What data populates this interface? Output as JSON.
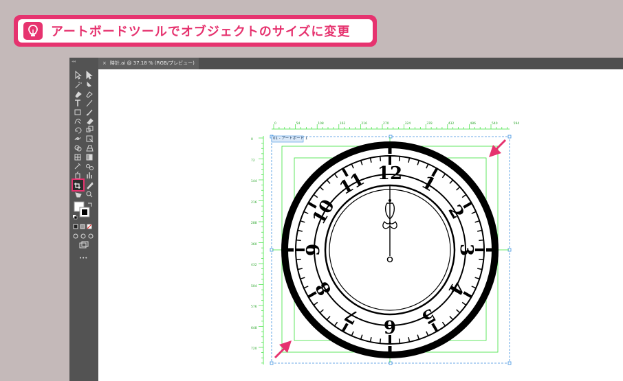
{
  "banner": {
    "text": "アートボードツールでオブジェクトのサイズに変更",
    "icon": "lightbulb-icon",
    "accent": "#e6336f"
  },
  "document": {
    "tab_title": "時計.ai @ 37.18 % (RGB/プレビュー)",
    "close_glyph": "×"
  },
  "artboard": {
    "label": "01 - アートボード 1"
  },
  "rulers": {
    "top": [
      "0",
      "54",
      "108",
      "162",
      "216",
      "270",
      "324",
      "378",
      "432",
      "486",
      "540",
      "594"
    ],
    "left": [
      "0",
      "72",
      "144",
      "216",
      "288",
      "360",
      "432",
      "504",
      "576",
      "648",
      "720"
    ]
  },
  "clock": {
    "numerals": [
      "12",
      "1",
      "2",
      "3",
      "4",
      "5",
      "6",
      "7",
      "8",
      "9",
      "10",
      "11"
    ]
  },
  "toolbar": {
    "more_label": "•••",
    "active_tool": "artboard-tool"
  }
}
